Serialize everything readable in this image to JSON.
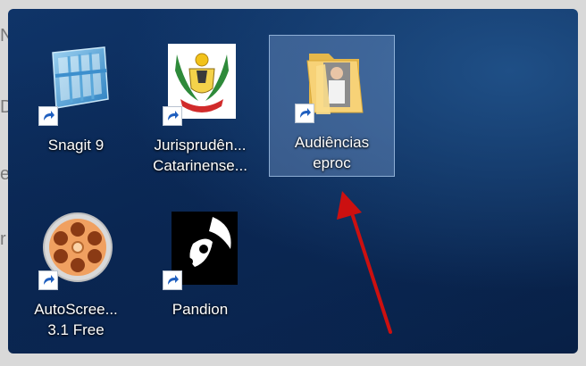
{
  "desktop_icons": [
    {
      "name": "snagit",
      "label_lines": [
        "Snagit 9"
      ],
      "selected": false
    },
    {
      "name": "jurisprudencia",
      "label_lines": [
        "Jurisprudên...",
        "Catarinense..."
      ],
      "selected": false
    },
    {
      "name": "audiencias",
      "label_lines": [
        "Audiências",
        "eproc"
      ],
      "selected": true
    },
    {
      "name": "autoscreen",
      "label_lines": [
        "AutoScree...",
        "3.1 Free"
      ],
      "selected": false
    },
    {
      "name": "pandion",
      "label_lines": [
        "Pandion"
      ],
      "selected": false
    }
  ],
  "annotation": {
    "arrow_color": "#cc1010",
    "points_to": "audiencias"
  },
  "colors": {
    "desktop_bg": "#0b2a58",
    "selection": "#7da0d2",
    "label_text": "#ffffff"
  }
}
